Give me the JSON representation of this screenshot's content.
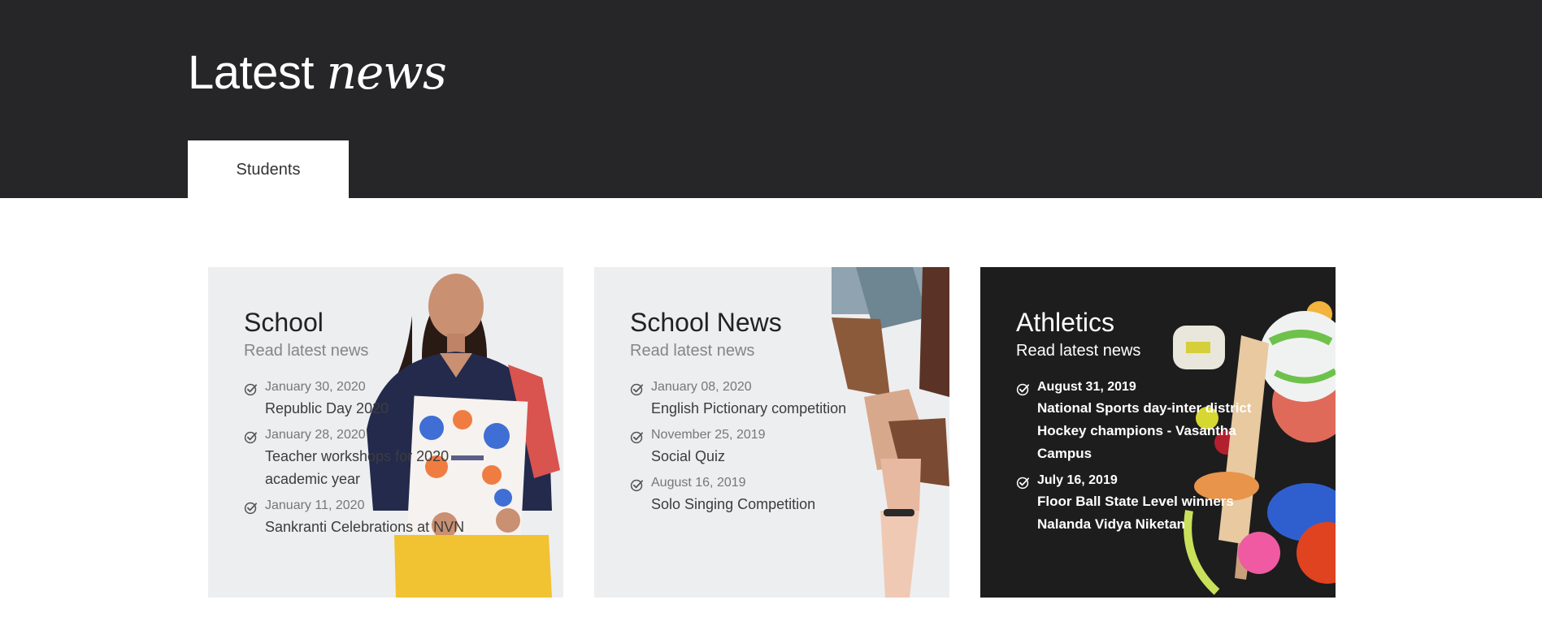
{
  "header": {
    "title_plain": "Latest",
    "title_em": "news",
    "tabs": [
      {
        "label": "Students"
      }
    ]
  },
  "cards": [
    {
      "title": "School",
      "subtitle": "Read latest news",
      "image": "student-with-book-photo",
      "items": [
        {
          "date": "January 30, 2020",
          "title": "Republic Day 2020"
        },
        {
          "date": "January 28, 2020",
          "title": "Teacher workshops for 2020 academic year"
        },
        {
          "date": "January 11, 2020",
          "title": "Sankranti Celebrations at NVN"
        }
      ]
    },
    {
      "title": "School News",
      "subtitle": "Read latest news",
      "image": "stacked-hands-photo",
      "items": [
        {
          "date": "January 08, 2020",
          "title": "English Pictionary competition"
        },
        {
          "date": "November 25, 2019",
          "title": "Social Quiz"
        },
        {
          "date": "August 16, 2019",
          "title": "Solo Singing Competition"
        }
      ]
    },
    {
      "title": "Athletics",
      "subtitle": "Read latest news",
      "image": "sports-equipment-photo",
      "items": [
        {
          "date": "August 31, 2019",
          "title": "National Sports day-inter district Hockey champions - Vasantha Campus"
        },
        {
          "date": "July 16, 2019",
          "title": "Floor Ball State Level winners Nalanda Vidya Niketan"
        }
      ]
    }
  ],
  "icons": {
    "item": "check-circle-icon"
  },
  "colors": {
    "header_bg": "#262628",
    "card_light_bg": "#edeef0",
    "card_dark_bg": "#1d1d1e"
  }
}
